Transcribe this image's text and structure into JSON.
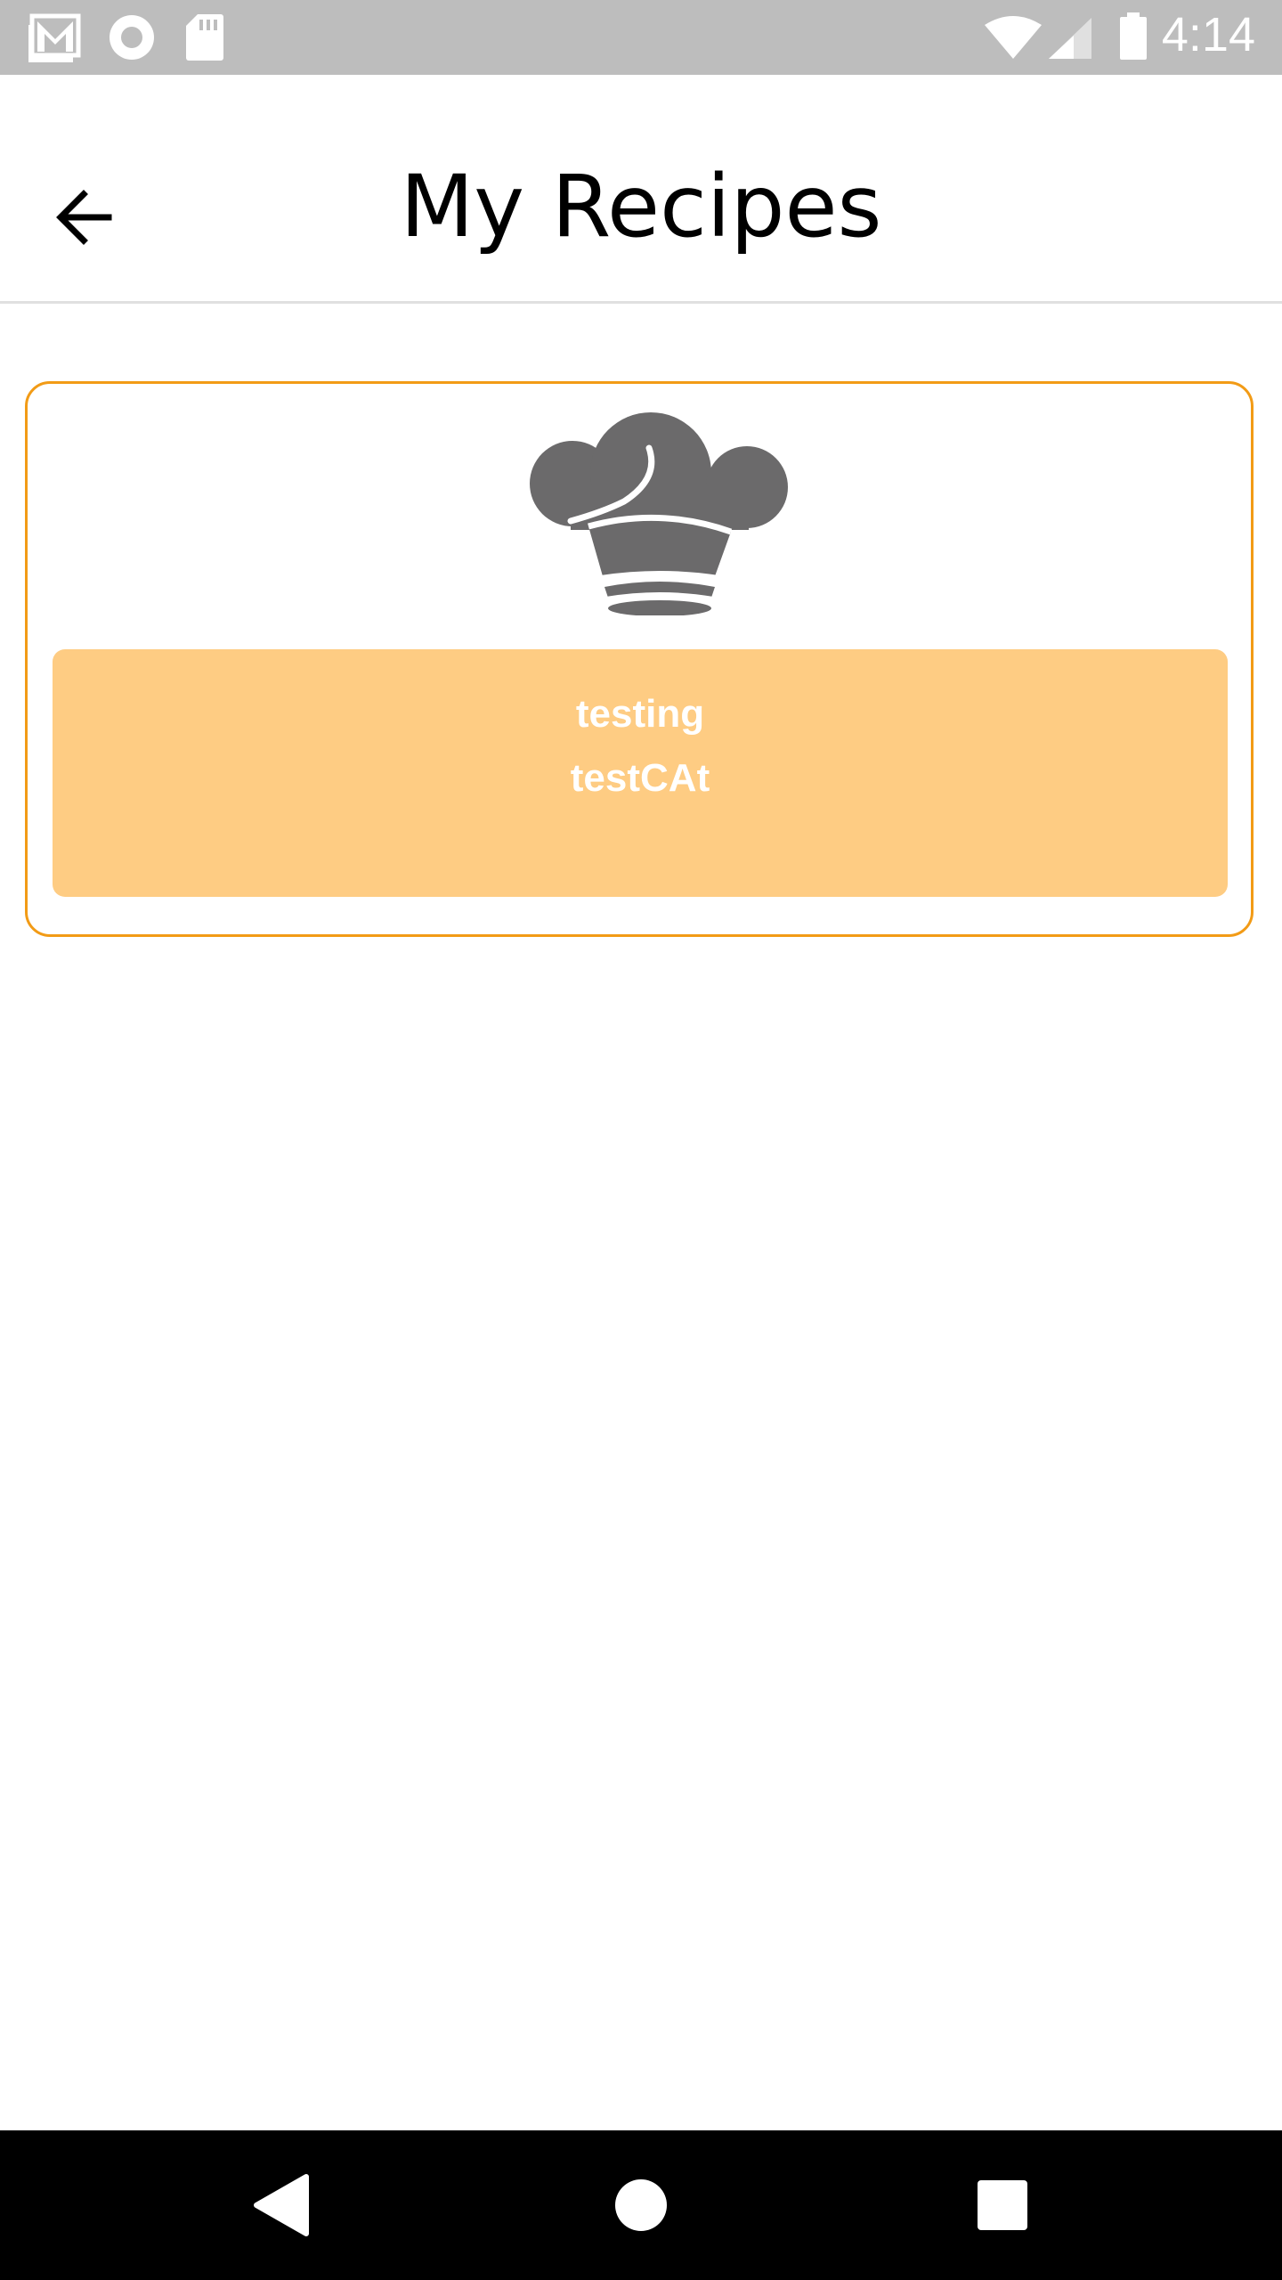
{
  "status_bar": {
    "time": "4:14",
    "left_icons": [
      "gmail-icon",
      "record-icon",
      "sd-card-icon"
    ],
    "right_icons": [
      "wifi-icon",
      "signal-icon",
      "battery-icon"
    ]
  },
  "app_bar": {
    "title": "My Recipes",
    "back_icon": "arrow-back-icon"
  },
  "recipes": [
    {
      "name": "testing",
      "category": "testCAt",
      "icon": "chef-hat-icon"
    }
  ],
  "nav_bar": {
    "icons": [
      "back-triangle-icon",
      "home-circle-icon",
      "recents-square-icon"
    ]
  },
  "colors": {
    "card_border": "#f29b16",
    "card_info_bg": "#fecc83",
    "status_bar_bg": "#bdbdbd",
    "icon_gray": "#6b6a6b"
  }
}
